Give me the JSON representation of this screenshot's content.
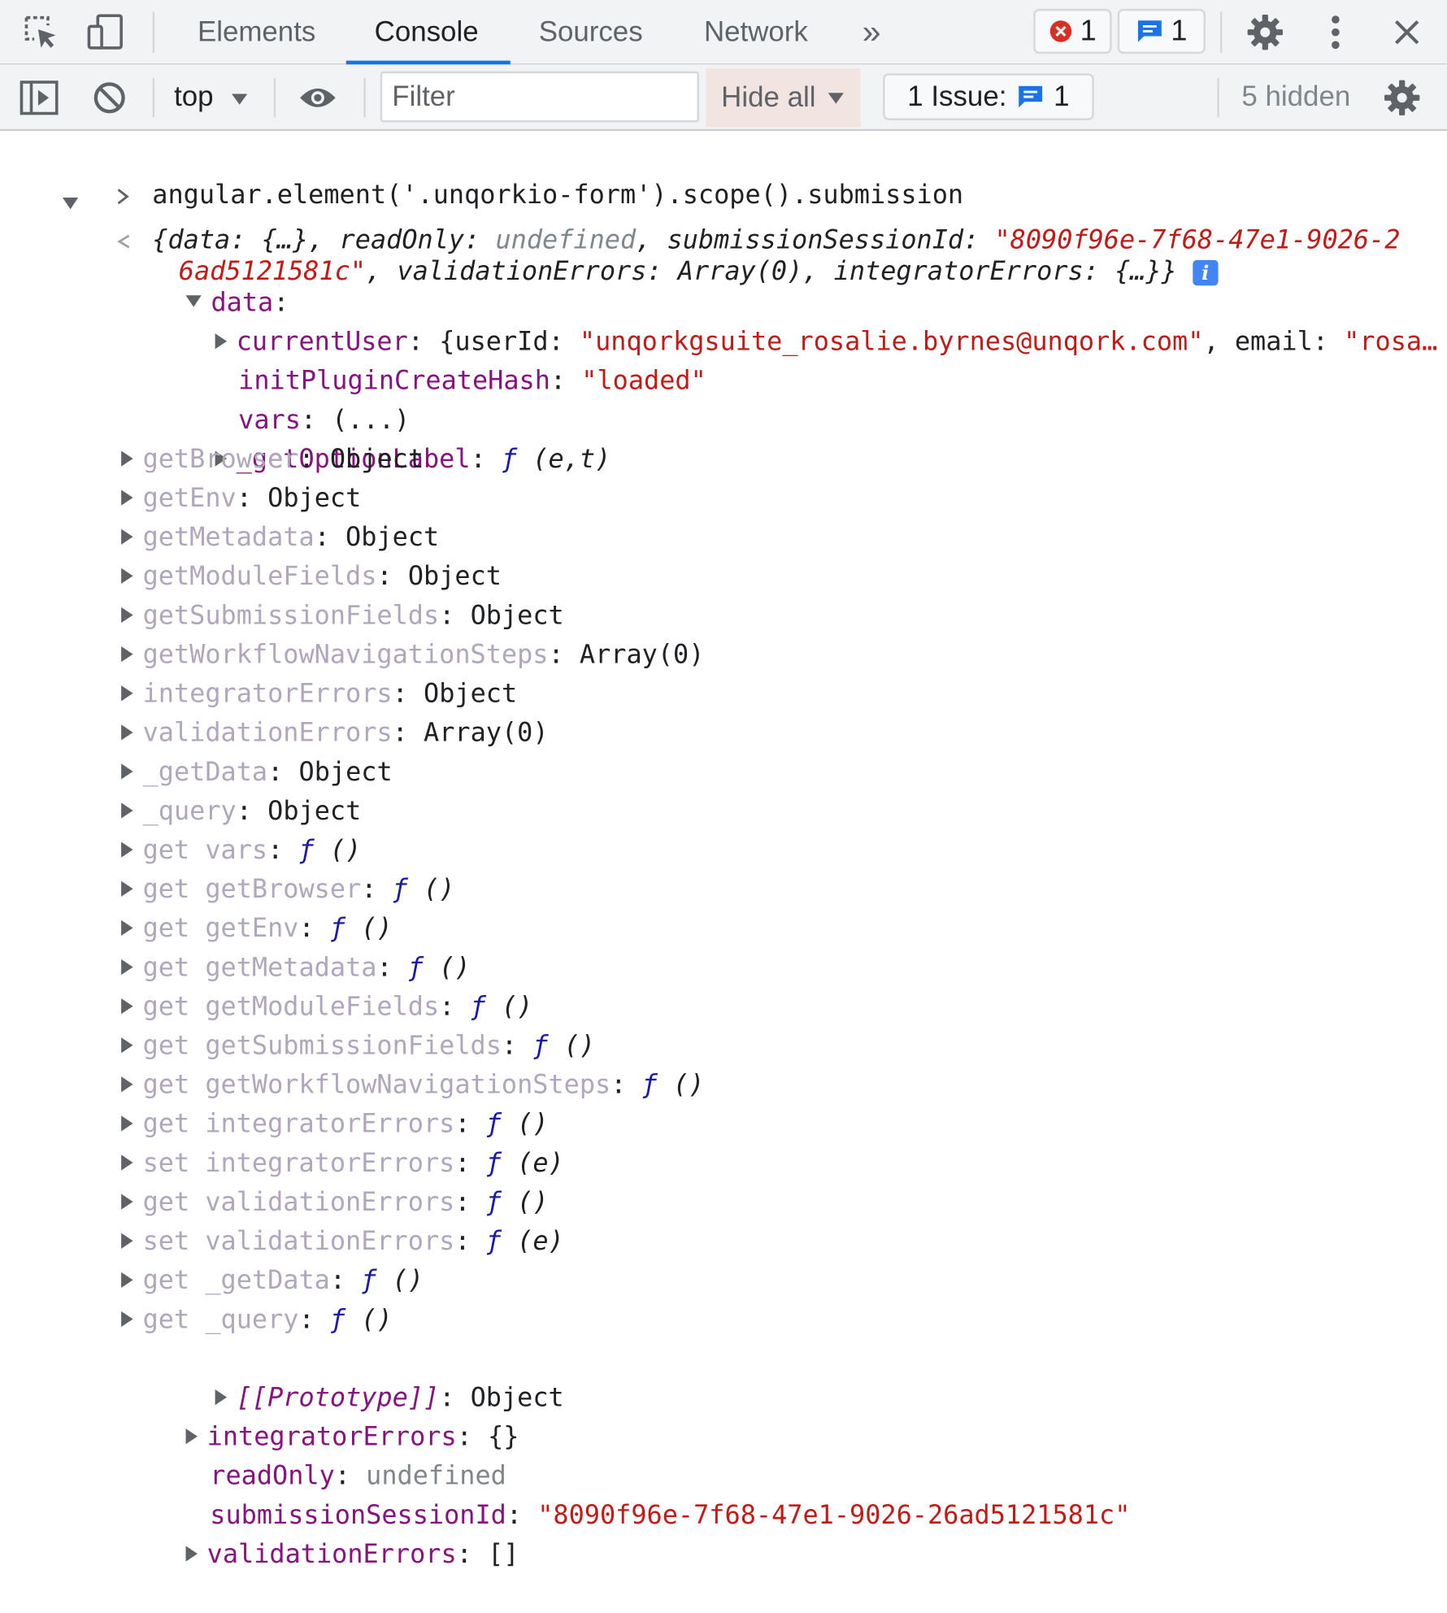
{
  "tabs": {
    "items": [
      "Elements",
      "Console",
      "Sources",
      "Network"
    ],
    "more": "»",
    "error_count": "1",
    "message_count": "1"
  },
  "toolbar": {
    "context": "top",
    "filter_placeholder": "Filter",
    "levels": "Hide all",
    "issues_label": "1 Issue:",
    "issues_count": "1",
    "hidden": "5 hidden"
  },
  "console": {
    "command": "angular.element('.unqorkio-form').scope().submission",
    "summary": {
      "open": "{data: {…}, readOnly: ",
      "undefined": "undefined",
      "session_key": ", submissionSessionId: ",
      "session_val_part1": "\"8090f96e-7f68-47e1-9026-2",
      "session_val_part2": "6ad5121581c\"",
      "rest": ", validationErrors: Array(0), integratorErrors: {…}}",
      "info": "i"
    },
    "data_key": "data",
    "current_user": {
      "key": "currentUser",
      "user_id_key": "{userId: ",
      "user_id_val": "\"unqorkgsuite_rosalie.byrnes@unqork.com\"",
      "email_key": ", email: ",
      "email_val": "\"rosa…"
    },
    "init_plugin": {
      "key": "initPluginCreateHash",
      "val": "\"loaded\""
    },
    "vars": {
      "key": "vars",
      "val": "(...)"
    },
    "get_option_label": {
      "key": "_getOptionLabel",
      "f": "ƒ",
      "args": " (e,t)"
    },
    "object_props": [
      {
        "key": "getBrowser",
        "val": "Object"
      },
      {
        "key": "getEnv",
        "val": "Object"
      },
      {
        "key": "getMetadata",
        "val": "Object"
      },
      {
        "key": "getModuleFields",
        "val": "Object"
      },
      {
        "key": "getSubmissionFields",
        "val": "Object"
      },
      {
        "key": "getWorkflowNavigationSteps",
        "val": "Array(0)"
      },
      {
        "key": "integratorErrors",
        "val": "Object"
      },
      {
        "key": "validationErrors",
        "val": "Array(0)"
      },
      {
        "key": "_getData",
        "val": "Object"
      },
      {
        "key": "_query",
        "val": "Object"
      }
    ],
    "accessors": [
      {
        "key": "get vars",
        "f": "ƒ",
        "args": " ()"
      },
      {
        "key": "get getBrowser",
        "f": "ƒ",
        "args": " ()"
      },
      {
        "key": "get getEnv",
        "f": "ƒ",
        "args": " ()"
      },
      {
        "key": "get getMetadata",
        "f": "ƒ",
        "args": " ()"
      },
      {
        "key": "get getModuleFields",
        "f": "ƒ",
        "args": " ()"
      },
      {
        "key": "get getSubmissionFields",
        "f": "ƒ",
        "args": " ()"
      },
      {
        "key": "get getWorkflowNavigationSteps",
        "f": "ƒ",
        "args": " ()"
      },
      {
        "key": "get integratorErrors",
        "f": "ƒ",
        "args": " ()"
      },
      {
        "key": "set integratorErrors",
        "f": "ƒ",
        "args": " (e)"
      },
      {
        "key": "get validationErrors",
        "f": "ƒ",
        "args": " ()"
      },
      {
        "key": "set validationErrors",
        "f": "ƒ",
        "args": " (e)"
      },
      {
        "key": "get _getData",
        "f": "ƒ",
        "args": " ()"
      },
      {
        "key": "get _query",
        "f": "ƒ",
        "args": " ()"
      }
    ],
    "prototype": {
      "key": "[[Prototype]]",
      "val": "Object"
    },
    "integrator_errors": {
      "key": "integratorErrors",
      "val": "{}"
    },
    "read_only": {
      "key": "readOnly",
      "val": "undefined"
    },
    "submission_session": {
      "key": "submissionSessionId",
      "val": "\"8090f96e-7f68-47e1-9026-26ad5121581c\""
    },
    "validation_errors": {
      "key": "validationErrors",
      "val": "[]"
    }
  },
  "colors": {
    "accent": "#1a73e8",
    "key": "#881280",
    "string": "#c41a16",
    "function": "#1a1aa6",
    "error": "#d93025"
  }
}
